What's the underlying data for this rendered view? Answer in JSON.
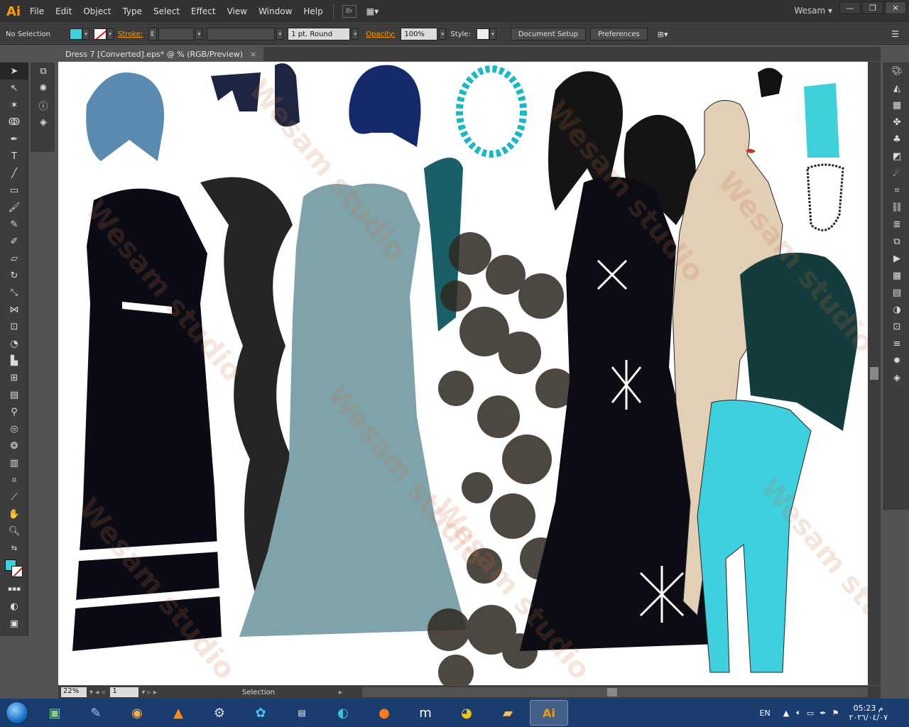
{
  "app": {
    "logo": "Ai",
    "user": "Wesam"
  },
  "menu": [
    "File",
    "Edit",
    "Object",
    "Type",
    "Select",
    "Effect",
    "View",
    "Window",
    "Help"
  ],
  "bridge_label": "Br",
  "control": {
    "selection_state": "No Selection",
    "stroke_label": "Stroke:",
    "brush_value": "1 pt. Round",
    "opacity_label": "Opacity:",
    "opacity_value": "100%",
    "style_label": "Style:",
    "document_setup": "Document Setup",
    "preferences": "Preferences"
  },
  "document_tab": {
    "title": "Dress 7 [Converted].eps* @ % (RGB/Preview)",
    "close": "×"
  },
  "status": {
    "zoom": "22%",
    "page": "1",
    "tool": "Selection"
  },
  "watermark_text": "Wesam studio",
  "taskbar": {
    "language": "EN",
    "time": "05:23 م",
    "date": "٢٠٢٦/٠٤/٠٧"
  },
  "colors": {
    "fill": "#3fd0dc",
    "accent": "#ff9a00",
    "canvas": "#ffffff"
  }
}
